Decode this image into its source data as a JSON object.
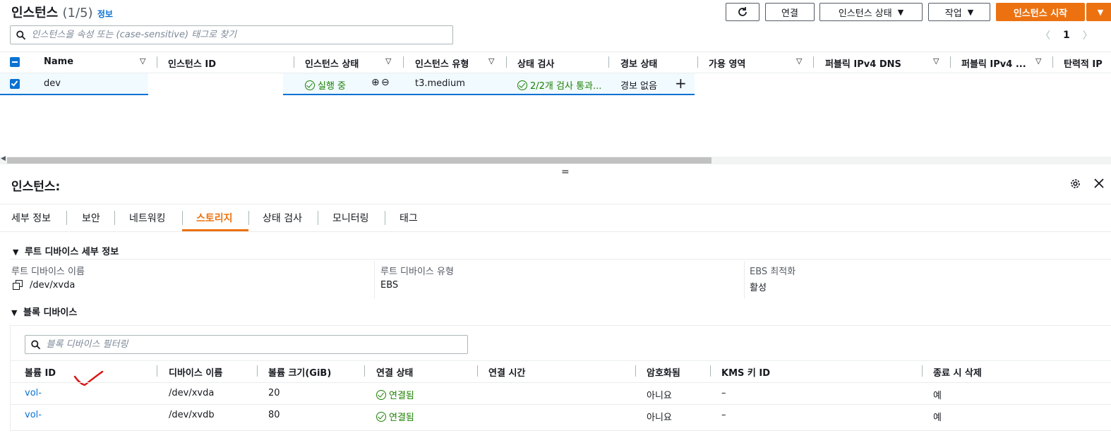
{
  "top": {
    "title": "인스턴스",
    "count": "(1/5)",
    "info": "정보",
    "search_placeholder": "인스턴스을 속성 또는 (case-sensitive) 태그로 찾기",
    "buttons": {
      "connect": "연결",
      "instance_state": "인스턴스 상태",
      "actions": "작업",
      "launch": "인스턴스 시작"
    },
    "page": "1"
  },
  "instances_table": {
    "headers": [
      "Name",
      "인스턴스 ID",
      "인스턴스 상태",
      "인스턴스 유형",
      "상태 검사",
      "경보 상태",
      "가용 영역",
      "퍼블릭 IPv4 DNS",
      "퍼블릭 IPv4 ...",
      "탄력적 IP"
    ],
    "row": {
      "name": "dev",
      "id": "",
      "state": "실행 중",
      "type": "t3.medium",
      "status_check": "2/2개 검사 통과...",
      "alarm": "경보 없음"
    }
  },
  "detail": {
    "title": "인스턴스:",
    "tabs": [
      "세부 정보",
      "보안",
      "네트워킹",
      "스토리지",
      "상태 검사",
      "모니터링",
      "태그"
    ],
    "active_tab": "스토리지",
    "root_section": "루트 디바이스 세부 정보",
    "root": {
      "device_name_label": "루트 디바이스 이름",
      "device_name": "/dev/xvda",
      "device_type_label": "루트 디바이스 유형",
      "device_type": "EBS",
      "ebs_opt_label": "EBS 최적화",
      "ebs_opt": "활성"
    },
    "block_section": "블록 디바이스",
    "block_search_placeholder": "블록 디바이스 필터링",
    "block_headers": [
      "볼륨 ID",
      "디바이스 이름",
      "볼륨 크기(GiB)",
      "연결 상태",
      "연결 시간",
      "암호화됨",
      "KMS 키 ID",
      "종료 시 삭제"
    ],
    "block_rows": [
      {
        "volume": "vol-",
        "device": "/dev/xvda",
        "size": "20",
        "state": "연결됨",
        "time": "",
        "encrypted": "아니요",
        "kms": "–",
        "delete": "예"
      },
      {
        "volume": "vol-",
        "device": "/dev/xvdb",
        "size": "80",
        "state": "연결됨",
        "time": "",
        "encrypted": "아니요",
        "kms": "–",
        "delete": "예"
      }
    ]
  },
  "colors": {
    "accent": "#0972d3",
    "primary_button": "#ec7211",
    "success": "#1d8102",
    "active_tab": "#ec7211",
    "annotation": "#d91515"
  }
}
